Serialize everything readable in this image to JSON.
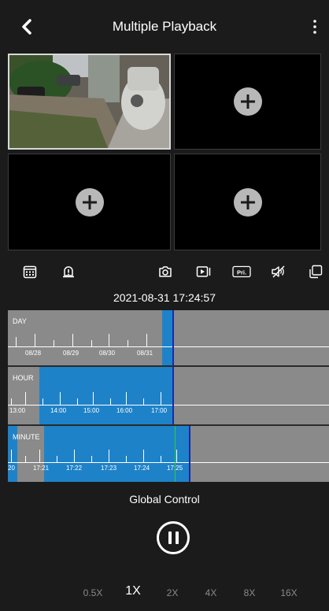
{
  "header": {
    "title": "Multiple Playback",
    "back_icon": "chevron-left-icon",
    "more_icon": "kebab-menu-icon"
  },
  "video_grid": {
    "cells": [
      {
        "state": "playing",
        "content": "camera-feed"
      },
      {
        "state": "empty",
        "icon": "add-icon"
      },
      {
        "state": "empty",
        "icon": "add-icon"
      },
      {
        "state": "empty",
        "icon": "add-icon"
      }
    ]
  },
  "toolbar": {
    "icons": [
      "calendar-icon",
      "alarm-icon",
      "snapshot-icon",
      "record-icon",
      "pri-label-icon",
      "mute-icon",
      "layout-icon"
    ],
    "pri_label": "Pri."
  },
  "datetime": "2021-08-31 17:24:57",
  "timelines": {
    "day": {
      "label": "DAY",
      "ticks": [
        "08/28",
        "08/29",
        "08/30",
        "08/31"
      ]
    },
    "hour": {
      "label": "HOUR",
      "ticks": [
        "13:00",
        "14:00",
        "15:00",
        "16:00",
        "17:00"
      ]
    },
    "minute": {
      "label": "MINUTE",
      "ticks": [
        "20",
        "17:21",
        "17:22",
        "17:23",
        "17:24",
        "17:25"
      ]
    }
  },
  "global_control": {
    "label": "Global Control",
    "pause_icon": "pause-icon"
  },
  "speeds": [
    "0.5X",
    "1X",
    "2X",
    "4X",
    "8X",
    "16X"
  ],
  "active_speed": "1X",
  "colors": {
    "background": "#1b1b1b",
    "recording": "#1e82c8",
    "timeline_bg": "#8a8a8a",
    "cursor": "#1a2aa8",
    "current_marker": "#2ecc40"
  }
}
